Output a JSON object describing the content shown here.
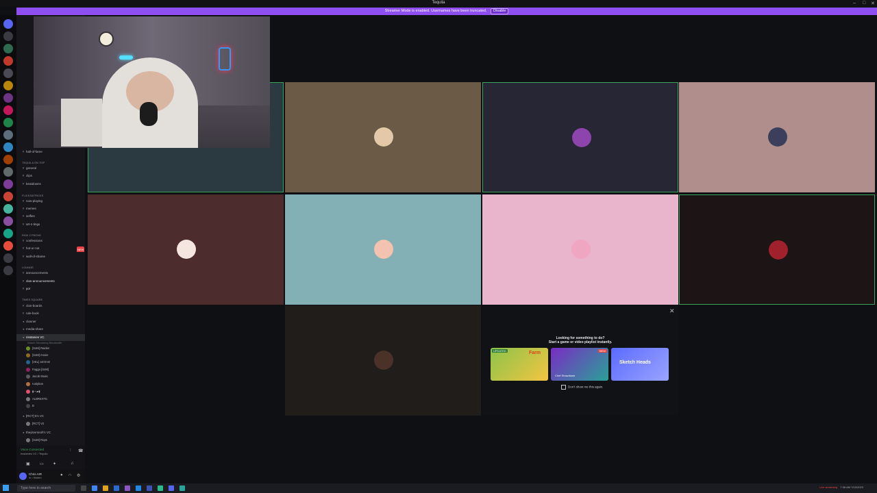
{
  "window": {
    "title": "Tequila",
    "controls": [
      "–",
      "□",
      "✕"
    ]
  },
  "streamer_bar": {
    "text": "Streamer Mode is enabled. Usernames have been truncated.",
    "button": "Disable"
  },
  "sidebar": {
    "categories": [
      "TEQUILA ON TOP",
      "FLICKS&TRICKS",
      "RISK Z PROVE",
      "LOUNGE",
      "TIMES SQUARE"
    ],
    "channels": [
      {
        "label": "hall-of-fame",
        "badge": ""
      },
      {
        "label": "general",
        "badge": ""
      },
      {
        "label": "clips",
        "badge": ""
      },
      {
        "label": "beatdowns",
        "badge": ""
      },
      {
        "label": "now-playing",
        "badge": ""
      },
      {
        "label": "memes",
        "badge": ""
      },
      {
        "label": "selfies",
        "badge": ""
      },
      {
        "label": "art-n-tings",
        "badge": ""
      },
      {
        "label": "confessions",
        "badge": ""
      },
      {
        "label": "hot-or-not",
        "badge": "NEW"
      },
      {
        "label": "wall-of-shame",
        "badge": ""
      },
      {
        "label": "announcements",
        "badge": ""
      },
      {
        "label": "clan-announcements",
        "badge": ""
      },
      {
        "label": "yo!",
        "badge": ""
      },
      {
        "label": "clan-boards",
        "badge": ""
      },
      {
        "label": "rule-book",
        "badge": ""
      },
      {
        "label": "clanner",
        "badge": ""
      },
      {
        "label": "media-share",
        "badge": ""
      }
    ],
    "voice_channel": "risstanies VC",
    "voice_sub": "Watch Streaming Bandwidth",
    "voice_users": [
      "[SoM] Raiden",
      "[SoM] mooie",
      "[VEL] arrrrmm",
      "Fagga [SoM]",
      "Jacob Music",
      "rustyboe",
      "▮ ▪ ▰▮",
      "ALBREXTE.",
      "B"
    ],
    "other_vcs": [
      "[RCT] 5's VC",
      "[RCT] V2",
      "theylovrsnoh's VC",
      "[SoM] Rops"
    ],
    "voice_status": "Voice Connected",
    "voice_location": "risstanies VC / Tequila",
    "user_name": "Chris AIR",
    "user_status": "In • Hidden"
  },
  "activity": {
    "heading_line1": "Looking for something to do?",
    "heading_line2": "Start a game or video playlist instantly.",
    "cards": [
      {
        "name": "Farm",
        "tag": "UPDATED",
        "color": "#8bc34a"
      },
      {
        "name": "Chef Showdown",
        "tag": "NEW",
        "color": "#7a2cc4"
      },
      {
        "name": "Sketch Heads",
        "tag": "",
        "color": "#5b6bff"
      }
    ],
    "checkbox_label": "Don't show me this again."
  },
  "taskbar": {
    "search_placeholder": "Type here to search",
    "tray_text": "Live streaming",
    "time": "7:36 AM",
    "date": "7/10/2023"
  },
  "colors": {
    "accent": "#8f4ef0",
    "speaking": "#3ba55d",
    "danger": "#ed4245"
  },
  "tiles": [
    {
      "name": "participant-1",
      "bg": "#2a3a40",
      "speaking": true
    },
    {
      "name": "participant-2",
      "bg": "#6b5a45",
      "speaking": false
    },
    {
      "name": "participant-3",
      "bg": "#262634",
      "speaking": true
    },
    {
      "name": "participant-4",
      "bg": "#b08e8c",
      "speaking": false
    },
    {
      "name": "participant-5",
      "bg": "#4d2c2e",
      "speaking": false
    },
    {
      "name": "participant-6",
      "bg": "#83b0b4",
      "speaking": false
    },
    {
      "name": "participant-7",
      "bg": "#e8b5cc",
      "speaking": false
    },
    {
      "name": "participant-8",
      "bg": "#1d1416",
      "speaking": true
    },
    {
      "name": "participant-9",
      "bg": "#211d1a",
      "speaking": false
    }
  ]
}
